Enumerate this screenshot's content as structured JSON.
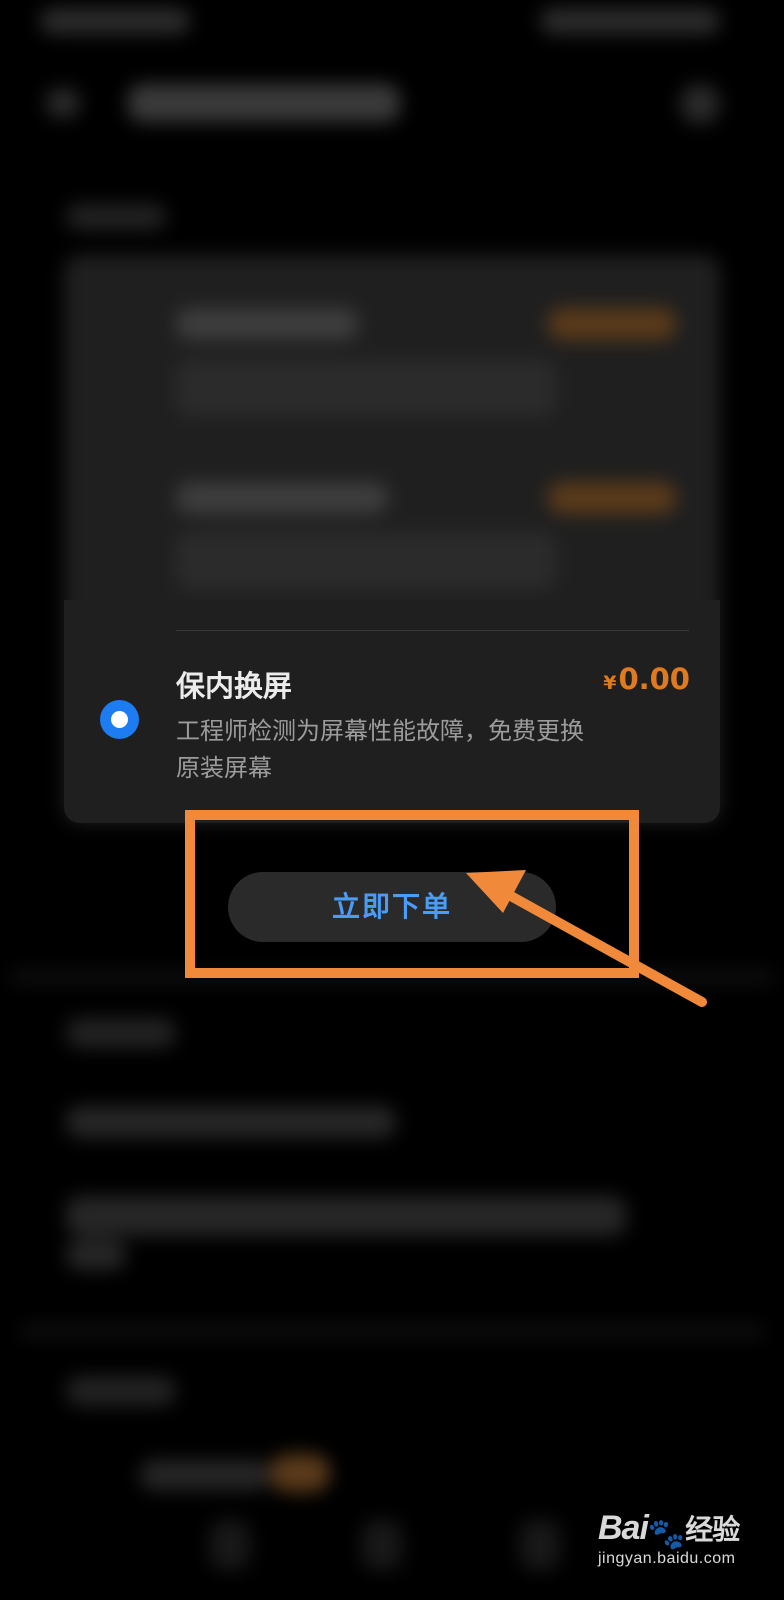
{
  "option": {
    "title": "保内换屏",
    "currency": "¥",
    "price": "0.00",
    "description": "工程师检测为屏幕性能故障，免费更换原装屏幕",
    "selected": true
  },
  "order_button": {
    "label": "立即下单"
  },
  "annotation": {
    "color": "#f08a3a"
  },
  "watermark": {
    "brand": "Bai",
    "brand_suffix": "经验",
    "url": "jingyan.baidu.com"
  },
  "colors": {
    "accent_blue": "#1d7cf2",
    "price_orange": "#e07a1e",
    "card_bg": "#1f1f1f"
  }
}
